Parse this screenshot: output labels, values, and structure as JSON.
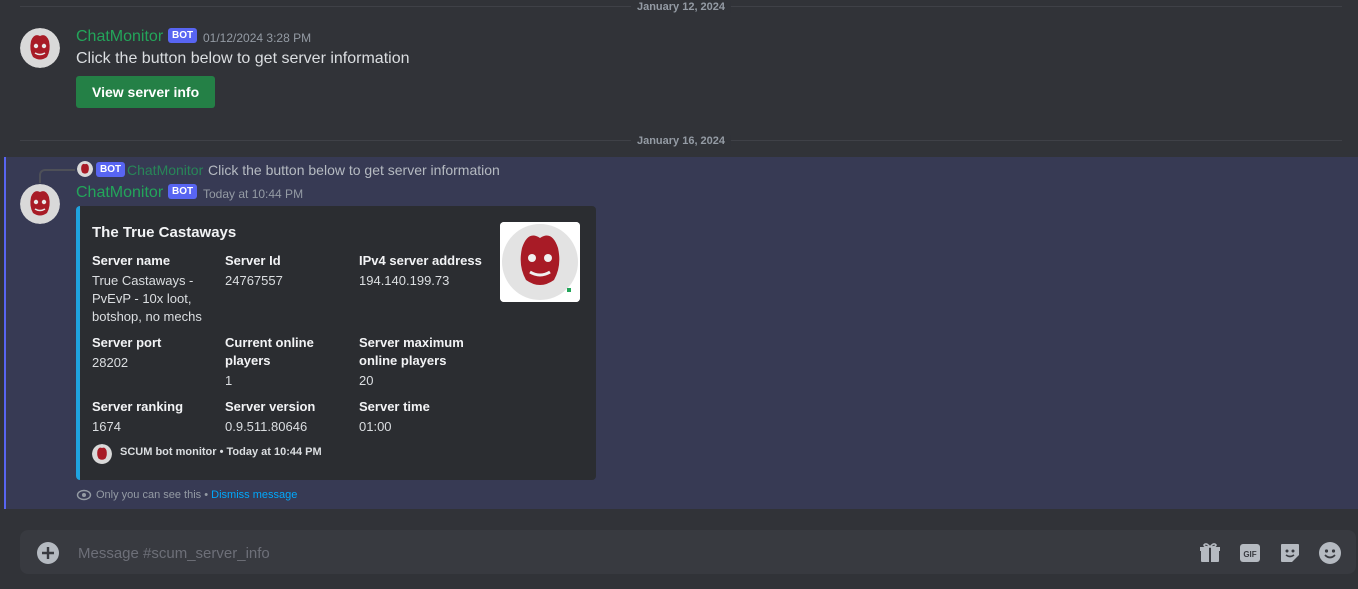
{
  "dates": {
    "first": "January 12, 2024",
    "second": "January 16, 2024"
  },
  "message1": {
    "author": "ChatMonitor",
    "bot_tag": "BOT",
    "timestamp": "01/12/2024 3:28 PM",
    "text": "Click the button below to get server information",
    "button_label": "View server info"
  },
  "reply": {
    "bot_tag": "BOT",
    "author": "ChatMonitor",
    "text": "Click the button below to get server information"
  },
  "message2": {
    "author": "ChatMonitor",
    "bot_tag": "BOT",
    "timestamp": "Today at 10:44 PM",
    "embed": {
      "title": "The True Castaways",
      "fields": [
        {
          "name": "Server name",
          "value": "True Castaways - PvEvP - 10x loot, botshop, no mechs"
        },
        {
          "name": "Server Id",
          "value": "24767557"
        },
        {
          "name": "IPv4 server address",
          "value": "194.140.199.73"
        },
        {
          "name": "Server port",
          "value": "28202"
        },
        {
          "name": "Current online players",
          "value": "1"
        },
        {
          "name": "Server maximum online players",
          "value": "20"
        },
        {
          "name": "Server ranking",
          "value": "1674"
        },
        {
          "name": "Server version",
          "value": "0.9.511.80646"
        },
        {
          "name": "Server time",
          "value": "01:00"
        }
      ],
      "footer": "SCUM bot monitor • Today at 10:44 PM"
    },
    "ephemeral_note": "Only you can see this •",
    "dismiss_label": "Dismiss message"
  },
  "composer": {
    "placeholder": "Message #scum_server_info"
  },
  "colors": {
    "accent_green": "#23a55a",
    "button_green": "#248046",
    "embed_border": "#1fa3e0",
    "bot_tag": "#5865f2"
  }
}
